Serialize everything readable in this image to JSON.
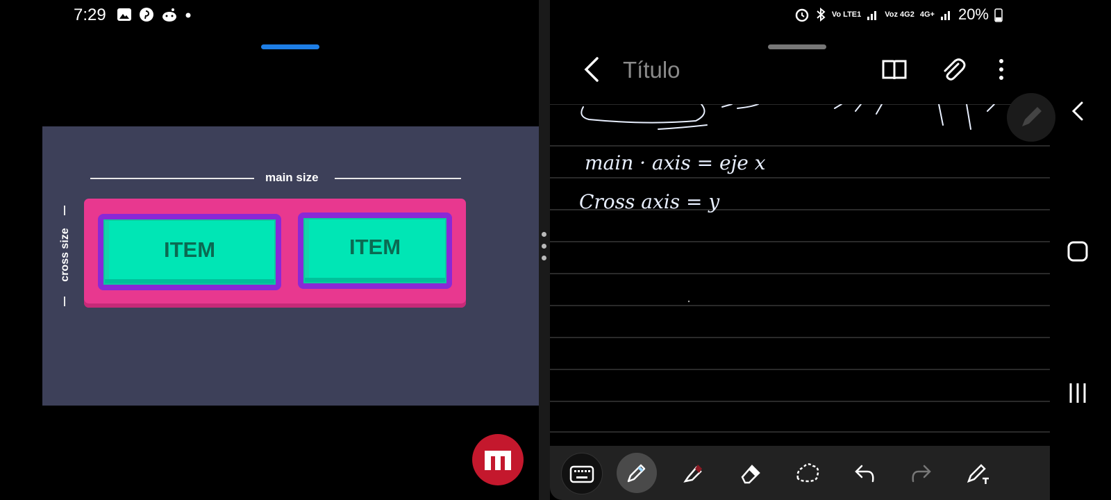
{
  "left_app": {
    "status": {
      "time": "7:29"
    },
    "video": {
      "main_size_label": "main size",
      "cross_size_label": "cross size",
      "items": [
        "ITEM",
        "ITEM"
      ],
      "colors": {
        "background": "#3d4059",
        "container": "#e8388f",
        "item_border": "#8a28d6",
        "item_fill": "#00e6b5"
      }
    },
    "logo_icon": "udemy-like-logo-icon"
  },
  "right_app": {
    "status": {
      "battery": "20%",
      "net1": "Vo LTE1",
      "net2": "Voz 4G2",
      "net3": "4G+"
    },
    "header": {
      "title": "Título"
    },
    "note_handwriting": [
      "main · axis = eje x",
      "Cross axis = y"
    ],
    "toolbar": [
      "keyboard-icon",
      "pen-icon",
      "highlighter-icon",
      "eraser-icon",
      "lasso-select-icon",
      "undo-icon",
      "redo-icon",
      "pen-settings-icon"
    ],
    "nav": [
      "back-nav-icon",
      "home-nav-icon",
      "recents-nav-icon"
    ]
  }
}
